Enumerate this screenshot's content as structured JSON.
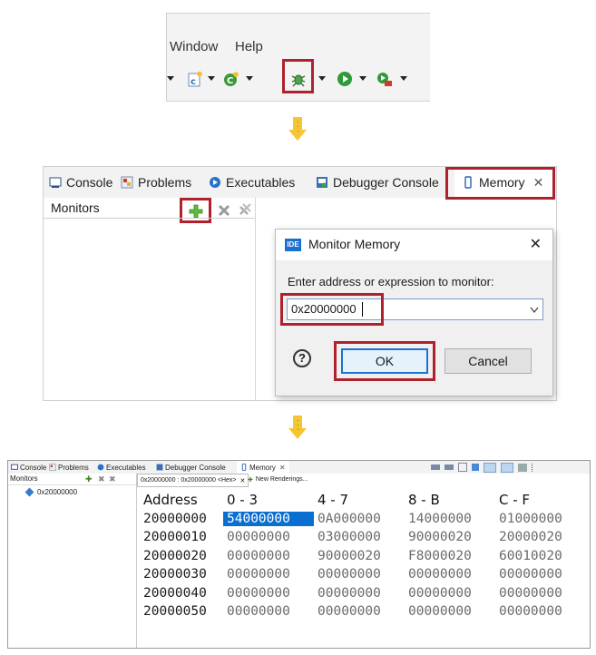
{
  "toolbar": {
    "menu": [
      "Window",
      "Help"
    ],
    "buttons": [
      "new-c-file-icon",
      "refresh-run-icon",
      "debug-icon",
      "run-icon",
      "external-tools-icon"
    ]
  },
  "step2": {
    "tabs": [
      {
        "label": "Console",
        "icon": "console-icon"
      },
      {
        "label": "Problems",
        "icon": "problems-icon"
      },
      {
        "label": "Executables",
        "icon": "executables-icon"
      },
      {
        "label": "Debugger Console",
        "icon": "debugger-console-icon"
      },
      {
        "label": "Memory",
        "icon": "memory-icon"
      }
    ],
    "monitors_label": "Monitors",
    "dialog": {
      "badge": "IDE",
      "title": "Monitor Memory",
      "prompt": "Enter address or expression to monitor:",
      "input_value": "0x20000000",
      "ok_label": "OK",
      "cancel_label": "Cancel",
      "help_glyph": "?",
      "close_glyph": "✕"
    }
  },
  "step3": {
    "tabs": [
      {
        "label": "Console"
      },
      {
        "label": "Problems"
      },
      {
        "label": "Executables"
      },
      {
        "label": "Debugger Console"
      },
      {
        "label": "Memory"
      }
    ],
    "monitors_label": "Monitors",
    "monitor_item": "0x20000000",
    "rendering_tab": "0x20000000 : 0x20000000 <Hex>",
    "new_renderings": "New Renderings...",
    "columns": [
      "Address",
      "0 - 3",
      "4 - 7",
      "8 - B",
      "C - F"
    ],
    "rows": [
      [
        "20000000",
        "54000000",
        "0A000000",
        "14000000",
        "01000000"
      ],
      [
        "20000010",
        "00000000",
        "03000000",
        "90000020",
        "20000020"
      ],
      [
        "20000020",
        "00000000",
        "90000020",
        "F8000020",
        "60010020"
      ],
      [
        "20000030",
        "00000000",
        "00000000",
        "00000000",
        "00000000"
      ],
      [
        "20000040",
        "00000000",
        "00000000",
        "00000000",
        "00000000"
      ],
      [
        "20000050",
        "00000000",
        "00000000",
        "00000000",
        "00000000"
      ]
    ]
  },
  "colors": {
    "highlight": "#b0212e",
    "arrow": "#f6c632",
    "selection": "#0a6fd0"
  }
}
